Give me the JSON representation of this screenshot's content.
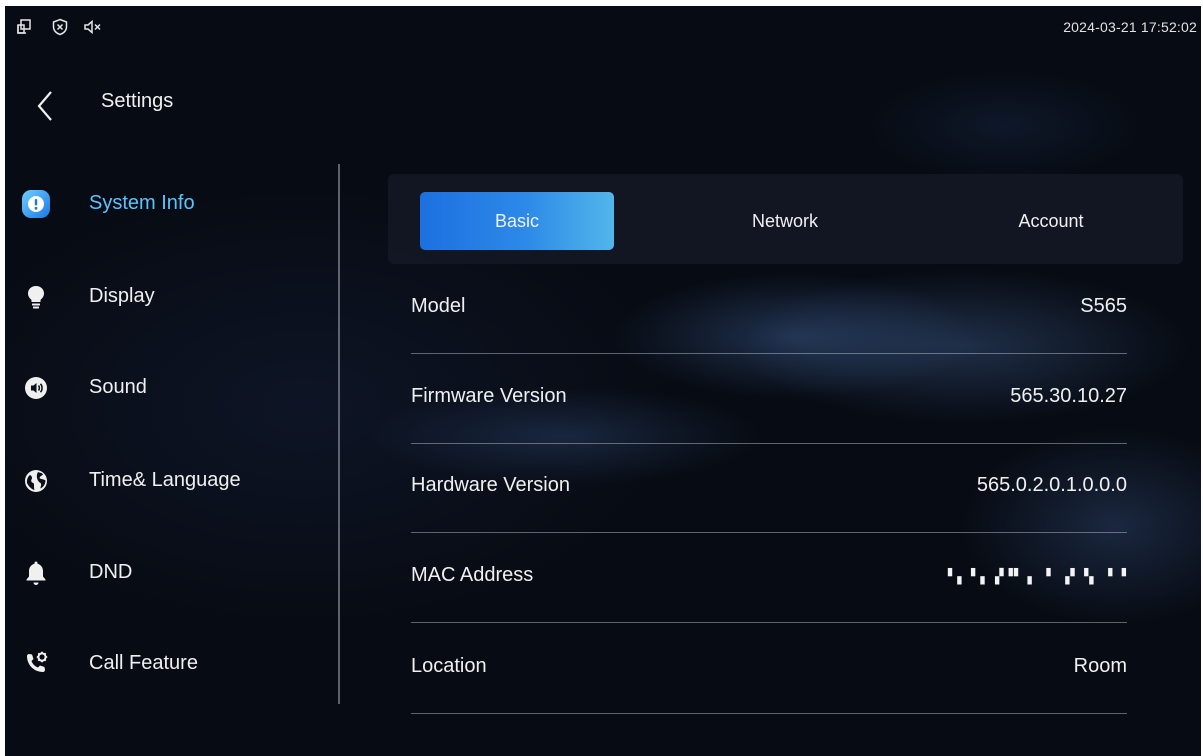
{
  "status_bar": {
    "icons": [
      "multi-window-icon",
      "shield-x-icon",
      "mute-icon"
    ],
    "datetime": "2024-03-21 17:52:02"
  },
  "header": {
    "title": "Settings",
    "back_icon": "back-arrow-icon"
  },
  "sidebar": {
    "items": [
      {
        "label": "System Info",
        "icon": "info-icon",
        "active": true
      },
      {
        "label": "Display",
        "icon": "lightbulb-icon"
      },
      {
        "label": "Sound",
        "icon": "speaker-icon"
      },
      {
        "label": "Time& Language",
        "icon": "globe-icon"
      },
      {
        "label": "DND",
        "icon": "bell-icon"
      },
      {
        "label": "Call Feature",
        "icon": "phone-gear-icon"
      }
    ]
  },
  "tabs": [
    {
      "label": "Basic",
      "active": true
    },
    {
      "label": "Network"
    },
    {
      "label": "Account"
    }
  ],
  "info_rows": [
    {
      "label": "Model",
      "value": "S565"
    },
    {
      "label": "Firmware Version",
      "value": "565.30.10.27"
    },
    {
      "label": "Hardware Version",
      "value": "565.0.2.0.1.0.0.0"
    },
    {
      "label": "MAC Address",
      "value": "▘▖▝▗ ▞▝▘▗ ▝ ▗▘▝▖ ▘▝",
      "masked": true
    },
    {
      "label": "Location",
      "value": "Room"
    }
  ],
  "colors": {
    "accent": "#5dc3ff",
    "tab_active_start": "#1c70e0",
    "tab_active_end": "#52b6ea",
    "background": "#070b13"
  }
}
